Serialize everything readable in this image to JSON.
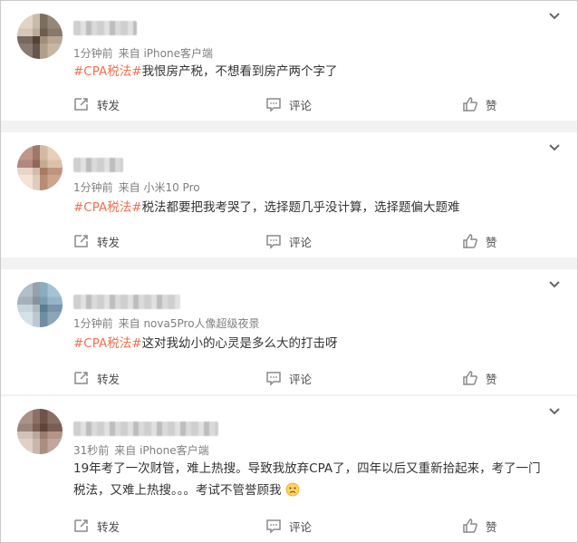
{
  "posts": [
    {
      "meta": {
        "time": "1分钟前",
        "source": "来自 iPhone客户端"
      },
      "tag": "#CPA税法#",
      "text": "我恨房产税，不想看到房产两个字了",
      "actions": {
        "repost": "转发",
        "comment": "评论",
        "like": "赞"
      }
    },
    {
      "meta": {
        "time": "1分钟前",
        "source": "来自 小米10 Pro"
      },
      "tag": "#CPA税法#",
      "text": "税法都要把我考哭了，选择题几乎没计算，选择题偏大题难",
      "actions": {
        "repost": "转发",
        "comment": "评论",
        "like": "赞"
      }
    },
    {
      "meta": {
        "time": "1分钟前",
        "source": "来自 nova5Pro人像超级夜景"
      },
      "tag": "#CPA税法#",
      "text": "这对我幼小的心灵是多么大的打击呀",
      "actions": {
        "repost": "转发",
        "comment": "评论",
        "like": "赞"
      }
    },
    {
      "meta": {
        "time": "31秒前",
        "source": "来自 iPhone客户端"
      },
      "line1": "19年考了一次财管，难上热搜。导致我放弃CPA了，四年以后又重新拾起来，考了一门",
      "line2": "税法，又难上热搜。。。考试不管誉顾我",
      "emoji": "sad-face-emoji",
      "actions": {
        "repost": "转发",
        "comment": "评论",
        "like": "赞"
      }
    }
  ],
  "colors": {
    "tag": "#eb7350",
    "meta": "#808080",
    "text": "#333333",
    "divider": "#f2f2f2"
  },
  "icons": [
    "chevron-down-icon",
    "repost-icon",
    "comment-icon",
    "like-icon"
  ]
}
